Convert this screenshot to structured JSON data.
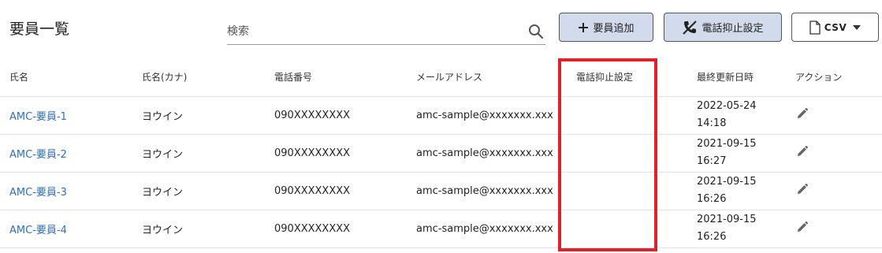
{
  "page": {
    "title": "要員一覧"
  },
  "search": {
    "placeholder": "検索",
    "value": ""
  },
  "toolbar": {
    "add_label": "要員追加",
    "suppress_label": "電話抑止設定",
    "csv_label": "CSV"
  },
  "table": {
    "headers": [
      "氏名",
      "氏名(カナ)",
      "電話番号",
      "メールアドレス",
      "電話抑止設定",
      "最終更新日時",
      "アクション"
    ],
    "rows": [
      {
        "name": "AMC-要員-1",
        "kana": "ヨウイン",
        "phone": "090XXXXXXXX",
        "email": "amc-sample@xxxxxxx.xxx",
        "suppress": "",
        "updated_date": "2022-05-24",
        "updated_time": "14:18"
      },
      {
        "name": "AMC-要員-2",
        "kana": "ヨウイン",
        "phone": "090XXXXXXXX",
        "email": "amc-sample@xxxxxxx.xxx",
        "suppress": "",
        "updated_date": "2021-09-15",
        "updated_time": "16:27"
      },
      {
        "name": "AMC-要員-3",
        "kana": "ヨウイン",
        "phone": "090XXXXXXXX",
        "email": "amc-sample@xxxxxxx.xxx",
        "suppress": "",
        "updated_date": "2021-09-15",
        "updated_time": "16:26"
      },
      {
        "name": "AMC-要員-4",
        "kana": "ヨウイン",
        "phone": "090XXXXXXXX",
        "email": "amc-sample@xxxxxxx.xxx",
        "suppress": "",
        "updated_date": "2021-09-15",
        "updated_time": "16:26"
      }
    ]
  },
  "icons": {
    "search": "search-icon",
    "add": "plus-icon",
    "suppress": "phone-off-icon",
    "csv": "file-icon",
    "dropdown": "caret-down-icon",
    "edit": "pencil-icon"
  },
  "colors": {
    "primary_button_bg": "#d2dbec",
    "link": "#2f6fbf",
    "highlight": "#e0202a"
  }
}
